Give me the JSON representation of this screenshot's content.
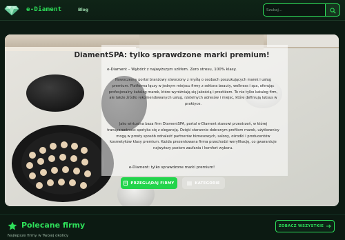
{
  "header": {
    "brand": "e-Diament",
    "nav_blog": "Blog",
    "search_placeholder": "Szukaj...",
    "logo_icon": "diamond-logo-icon",
    "search_icon": "search-icon"
  },
  "hero": {
    "title": "DiamentSPA: tylko sprawdzone marki premium!",
    "tagline": "e-Diament – Wybórż z najwyższym szlifem. Zero stresu, 100% klasy.",
    "paragraph1": "Nowoczesny portal branżowy stworzony z myślą o osobach poszukujących marek i usług premium. Platforma łączy w jednym miejscu firmy z sektora beauty, wellness i spa, oferując profesjonalny katalog marek, które wyróżniają się jakością i prestiżem. To nie tylko katalog firm, ale także źródło rekomendowanych usług, rzetelnych adresów i miejsc, które definiują luksus w praktyce.",
    "paragraph2": "Jako wirtualna baza firm DiamentSPA, portal e-Diament stanowi przestrzeń, w której transparentność spotyka się z elegancją. Dzięki starannie dobranym profilom marek, użytkownicy mogą w prosty sposób odnaleźć partnerów biznesowych, salony, ośrodki i producentów kosmetyków klasy premium. Każda prezentowana firma przechodzi weryfikację, co gwarantuje najwyższy poziom zaufania i komfort wyboru.",
    "footer": "e-Diament: tylko sprawdzone marki premium!",
    "browse_button": "PRZEGLĄDAJ FIRMY",
    "categories_button": "KATEGORIE",
    "browse_icon": "building-icon",
    "categories_icon": "list-icon"
  },
  "featured": {
    "title": "Polecane firmy",
    "subtitle": "Najlepsze firmy w Twojej okolicy",
    "see_all": "ZOBACZ WSZYSTKIE",
    "star_icon": "star-icon",
    "arrow_icon": "arrow-right-icon"
  },
  "colors": {
    "accent": "#2ee05a",
    "background": "#0c1a12"
  }
}
